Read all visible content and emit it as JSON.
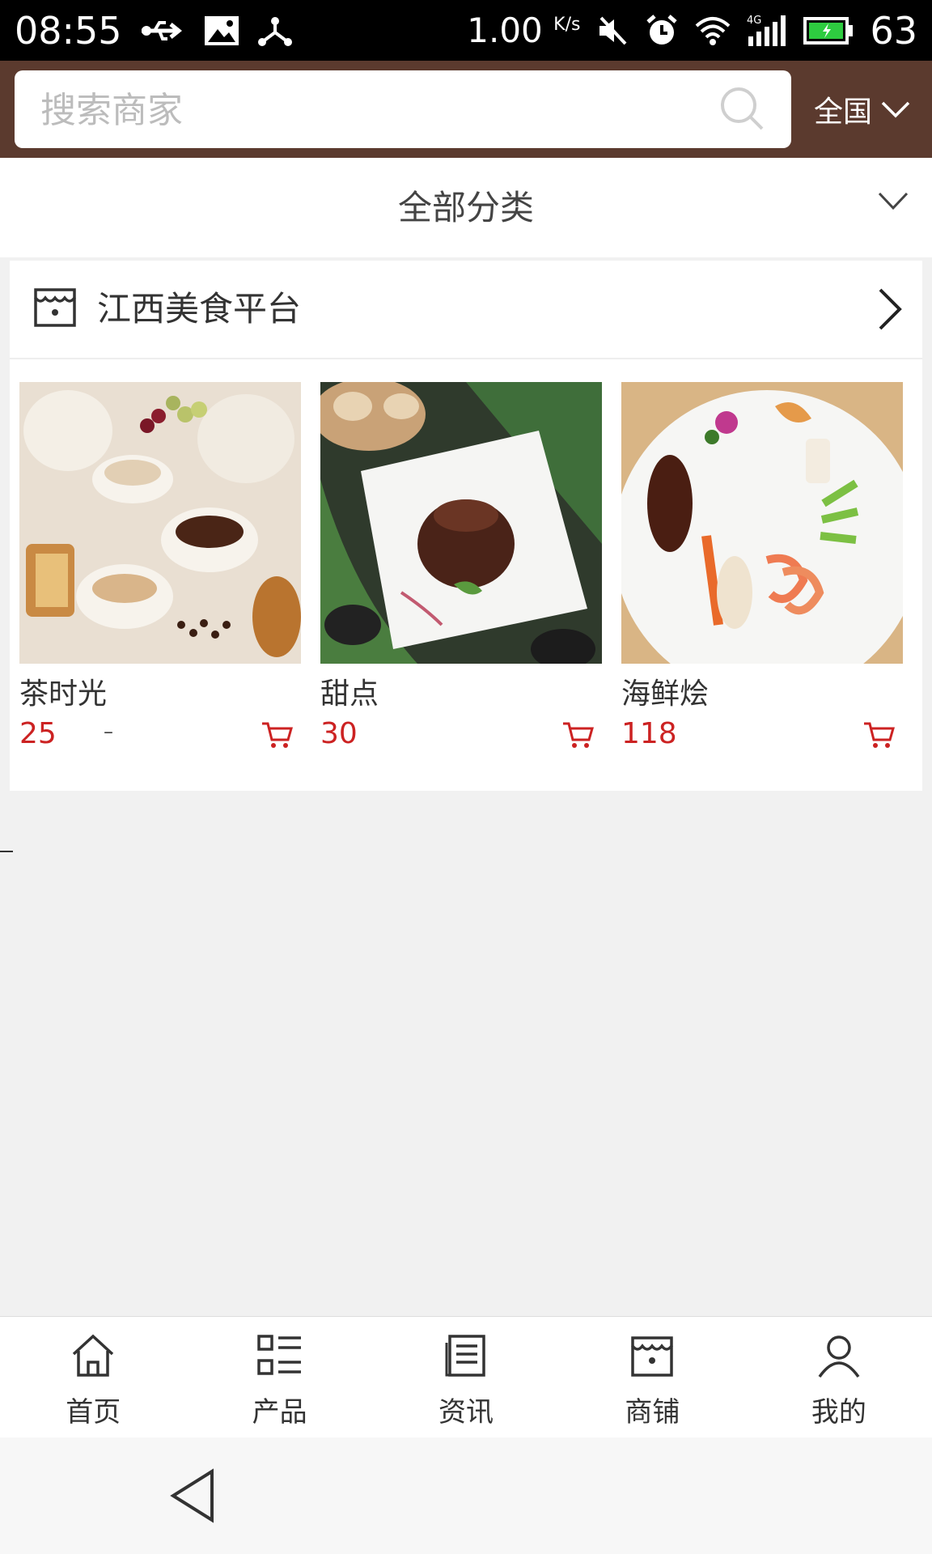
{
  "status_bar": {
    "time": "08:55",
    "speed": "1.00",
    "speed_unit": "K/s",
    "battery_percent": "63",
    "network": "4G"
  },
  "header": {
    "search_placeholder": "搜索商家",
    "region": "全国"
  },
  "category": {
    "title": "全部分类"
  },
  "shop": {
    "name": "江西美食平台",
    "products": [
      {
        "name": "茶时光",
        "price": "25",
        "extra": "–"
      },
      {
        "name": "甜点",
        "price": "30"
      },
      {
        "name": "海鲜烩",
        "price": "118"
      }
    ]
  },
  "bottom_nav": [
    {
      "label": "首页",
      "icon": "home-icon"
    },
    {
      "label": "产品",
      "icon": "grid-list-icon"
    },
    {
      "label": "资讯",
      "icon": "document-icon"
    },
    {
      "label": "商铺",
      "icon": "shop-icon"
    },
    {
      "label": "我的",
      "icon": "user-icon"
    }
  ],
  "colors": {
    "header_bg": "#5b3a2e",
    "price": "#cc2222",
    "page_bg": "#f1f1f1"
  }
}
